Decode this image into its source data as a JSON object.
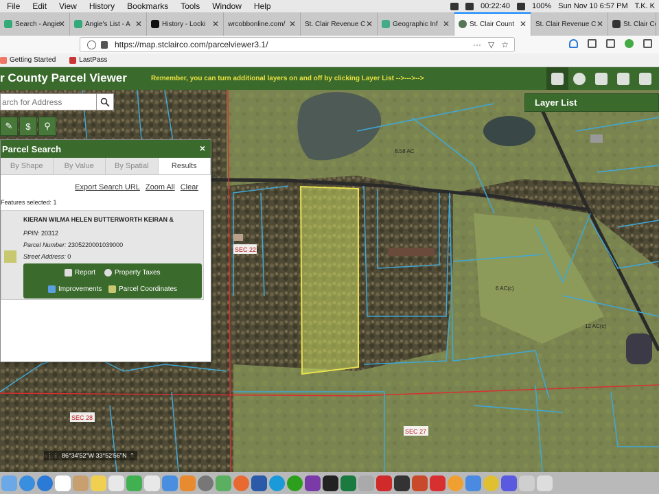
{
  "menubar": {
    "items": [
      "File",
      "Edit",
      "View",
      "History",
      "Bookmarks",
      "Tools",
      "Window",
      "Help"
    ],
    "timer": "00:22:40",
    "battery": "100%",
    "datetime": "Sun Nov 10  6:57 PM",
    "user": "T.K. K"
  },
  "tabs": [
    {
      "label": "Search - Angie",
      "active": false
    },
    {
      "label": "Angie's List - A",
      "active": false
    },
    {
      "label": "History - Locki",
      "active": false
    },
    {
      "label": "wrcobbonline.com/",
      "active": false
    },
    {
      "label": "St. Clair Revenue C",
      "active": false
    },
    {
      "label": "Geographic Inf",
      "active": false
    },
    {
      "label": "St. Clair Count",
      "active": true
    },
    {
      "label": "St. Clair Revenue C",
      "active": false
    },
    {
      "label": "St. Clair Count",
      "active": false
    }
  ],
  "url": "https://map.stclairco.com/parcelviewer3.1/",
  "url_actions": "···",
  "bookmarks": [
    "Getting Started",
    "LastPass"
  ],
  "app": {
    "title": "r County Parcel Viewer",
    "message": "Remember, you can turn additional layers on and off by clicking Layer List -->--->-->",
    "toolbar_icons": [
      "layers-icon",
      "basemap-icon",
      "measure-icon",
      "print-icon",
      "education-icon"
    ]
  },
  "search": {
    "placeholder": "arch for Address"
  },
  "quicktools": [
    "$",
    "⚲"
  ],
  "panel": {
    "title": "Parcel Search",
    "close": "×",
    "tabs": [
      {
        "label": "By Shape",
        "selected": false
      },
      {
        "label": "By Value",
        "selected": false
      },
      {
        "label": "By Spatial",
        "selected": false
      },
      {
        "label": "Results",
        "selected": true
      }
    ],
    "links": [
      "Export Search URL",
      "Zoom All",
      "Clear"
    ],
    "features_selected": "Features selected: 1",
    "result": {
      "owner": "KIERAN WILMA HELEN BUTTERWORTH KEIRAN &",
      "ppin_label": "PPIN:",
      "ppin": "20312",
      "parcel_label": "Parcel Number:",
      "parcel": "2305220001039000",
      "street_label": "Street Address:",
      "street": "0",
      "actions": [
        "Report",
        "Property Taxes",
        "Improvements",
        "Parcel Coordinates"
      ]
    }
  },
  "layer_list": "Layer List",
  "coordinates": "86°34'52\"W 33°52'56\"N",
  "map_labels": [
    {
      "text": "SEC 22"
    },
    {
      "text": "SEC 28"
    },
    {
      "text": "SEC 27"
    },
    {
      "text": "8.58 AC"
    },
    {
      "text": "12 AC(c)"
    },
    {
      "text": "6 AC(c)"
    }
  ],
  "colors": {
    "header_green": "#3a6a2c",
    "message_yellow": "#e8e040",
    "parcel_line": "#3fa8d8",
    "section_line": "#d83030",
    "selected_parcel": "#c8d860"
  },
  "dock_icons": [
    "finder",
    "safari",
    "calendar",
    "photos",
    "music",
    "mail",
    "firefox",
    "word",
    "excel",
    "powerpoint",
    "quickbooks",
    "onenote",
    "terminal",
    "preview",
    "sketch",
    "trash"
  ]
}
